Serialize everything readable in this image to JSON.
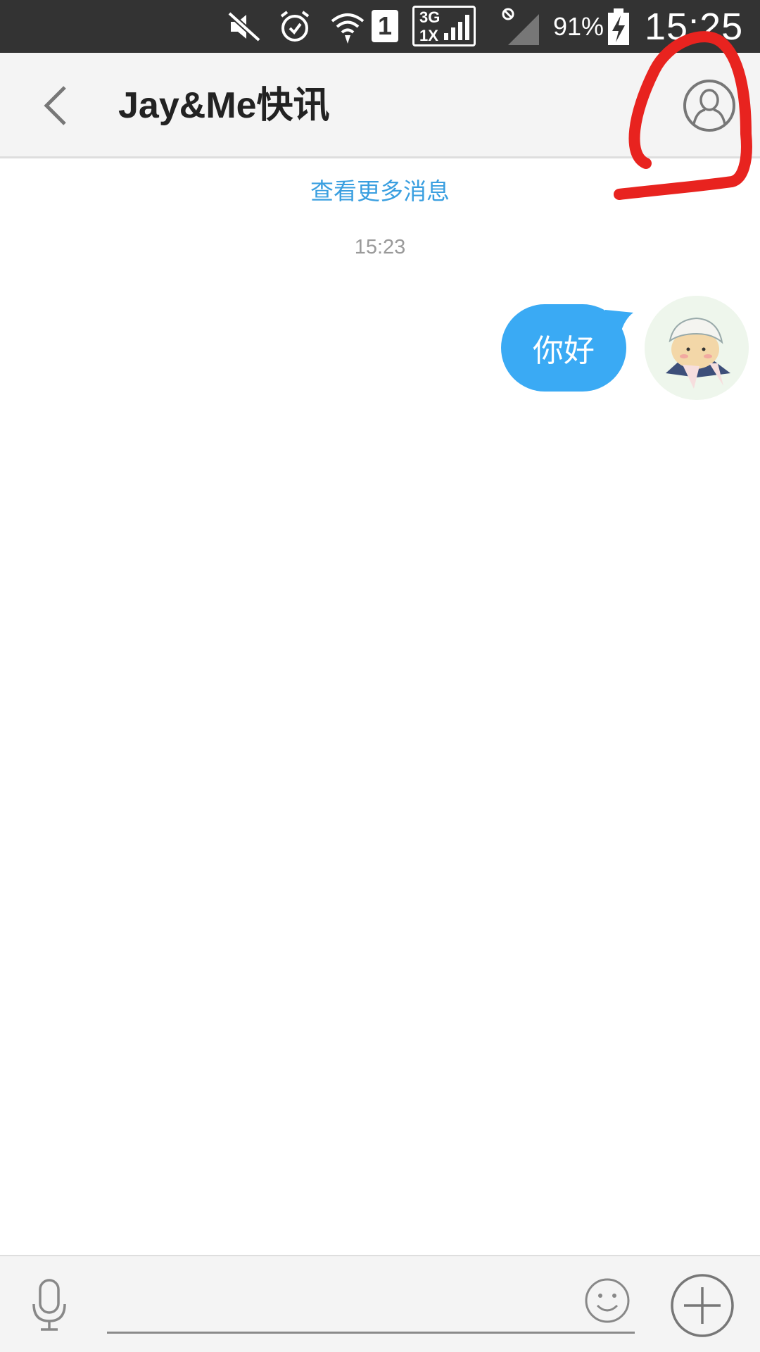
{
  "status_bar": {
    "network_top": "3G",
    "network_bottom": "1X",
    "sim_slot": "1",
    "battery_percent": "91%",
    "time": "15:25",
    "icons": [
      "mute-icon",
      "alarm-icon",
      "wifi-icon",
      "sim-icon",
      "signal-icon",
      "no-sim-signal-icon",
      "battery-charging-icon"
    ]
  },
  "header": {
    "title": "Jay&Me快讯",
    "back_icon": "chevron-left-icon",
    "profile_icon": "user-profile-icon"
  },
  "chat": {
    "load_more": "查看更多消息",
    "timestamp": "15:23",
    "messages": [
      {
        "text": "你好",
        "side": "right"
      }
    ]
  },
  "input_bar": {
    "text_value": "",
    "icons": [
      "microphone-icon",
      "emoji-icon",
      "plus-icon"
    ]
  },
  "colors": {
    "accent": "#3aaaf4",
    "link": "#3a9fe0",
    "status_bar": "#333333",
    "annotation": "#e8231f"
  }
}
